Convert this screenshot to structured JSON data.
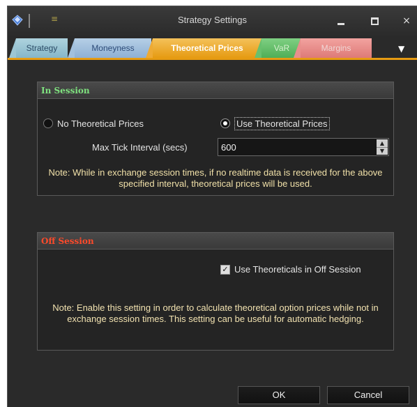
{
  "window": {
    "title": "Strategy Settings",
    "quick_access_glyph": "≡",
    "close_glyph": "×"
  },
  "tabs": [
    {
      "label": "Strategy",
      "color": "#9cc6d4"
    },
    {
      "label": "Moneyness",
      "color": "#a2c0dd"
    },
    {
      "label": "Theoretical Prices",
      "color": "#eeaa34",
      "selected": true
    },
    {
      "label": "VaR",
      "color": "#68c06e"
    },
    {
      "label": "Margins",
      "color": "#e88f8c"
    }
  ],
  "tabs_overflow_glyph": "▼",
  "in_session": {
    "title": "In Session",
    "no_theo_label": "No Theoretical Prices",
    "use_theo_label": "Use Theoretical Prices",
    "use_theo_selected": true,
    "max_tick_label": "Max Tick Interval (secs)",
    "max_tick_value": "600",
    "note": "Note: While in exchange session times, if no realtime data is received for the above specified interval, theoretical prices will be used."
  },
  "off_session": {
    "title": "Off Session",
    "use_theo_off_label": "Use Theoreticals in Off Session",
    "use_theo_off_checked": true,
    "note": "Note: Enable this setting in order to calculate theoretical option prices while not in exchange session times. This setting can be useful for automatic hedging."
  },
  "buttons": {
    "ok": "OK",
    "cancel": "Cancel"
  },
  "colors": {
    "selected_tab": "#e69b12",
    "in_session_title": "#7fe27f",
    "off_session_title": "#ff4a2a",
    "window_bg": "#2a2a2a"
  }
}
